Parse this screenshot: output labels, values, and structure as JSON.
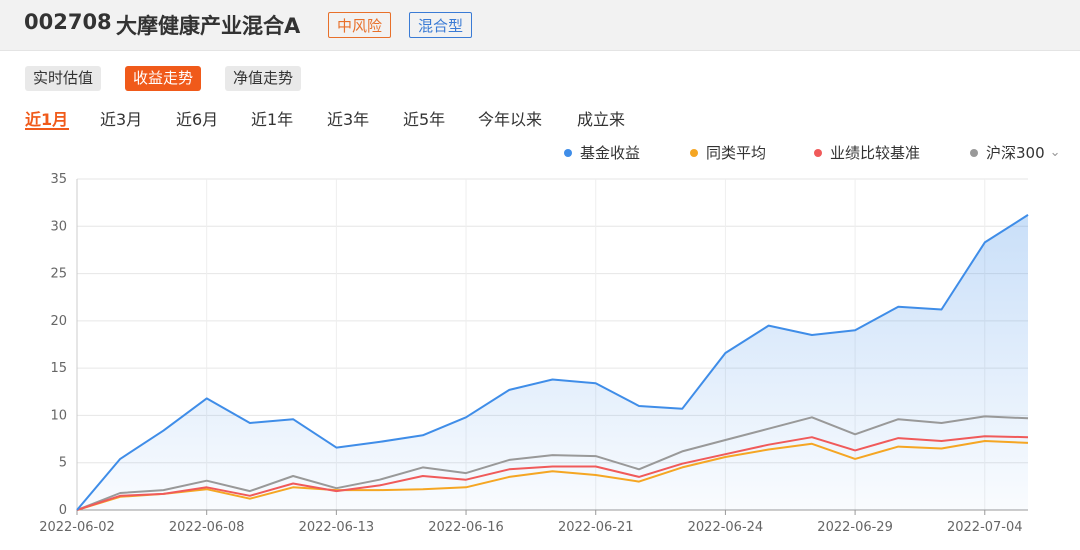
{
  "header": {
    "code": "002708",
    "name": "大摩健康产业混合A",
    "risk_tag": "中风险",
    "type_tag": "混合型"
  },
  "modes": [
    {
      "label": "实时估值",
      "active": false
    },
    {
      "label": "收益走势",
      "active": true
    },
    {
      "label": "净值走势",
      "active": false
    }
  ],
  "periods": [
    {
      "label": "近1月",
      "active": true
    },
    {
      "label": "近3月",
      "active": false
    },
    {
      "label": "近6月",
      "active": false
    },
    {
      "label": "近1年",
      "active": false
    },
    {
      "label": "近3年",
      "active": false
    },
    {
      "label": "近5年",
      "active": false
    },
    {
      "label": "今年以来",
      "active": false
    },
    {
      "label": "成立来",
      "active": false
    }
  ],
  "chart_data": {
    "type": "line",
    "title": "",
    "xlabel": "",
    "ylabel": "",
    "ylim": [
      0,
      35
    ],
    "yticks": [
      0,
      5,
      10,
      15,
      20,
      25,
      30,
      35
    ],
    "xtick_labels": [
      "2022-06-02",
      "2022-06-08",
      "2022-06-13",
      "2022-06-16",
      "2022-06-21",
      "2022-06-24",
      "2022-06-29",
      "2022-07-04"
    ],
    "xtick_indices": [
      0,
      3,
      6,
      9,
      12,
      15,
      18,
      21
    ],
    "grid": true,
    "legend": "top-right",
    "x": [
      "2022-06-02",
      "2022-06-06",
      "2022-06-07",
      "2022-06-08",
      "2022-06-09",
      "2022-06-10",
      "2022-06-13",
      "2022-06-14",
      "2022-06-15",
      "2022-06-16",
      "2022-06-17",
      "2022-06-20",
      "2022-06-21",
      "2022-06-22",
      "2022-06-23",
      "2022-06-24",
      "2022-06-27",
      "2022-06-28",
      "2022-06-29",
      "2022-06-30",
      "2022-07-01",
      "2022-07-04",
      "2022-07-05"
    ],
    "series": [
      {
        "name": "基金收益",
        "color": "#3f8de8",
        "area": true,
        "values": [
          0,
          5.4,
          8.4,
          11.8,
          9.2,
          9.6,
          6.6,
          7.2,
          7.9,
          9.8,
          12.7,
          13.8,
          13.4,
          11.0,
          10.7,
          16.6,
          19.5,
          18.5,
          19.0,
          21.5,
          21.2,
          28.3,
          31.2
        ]
      },
      {
        "name": "同类平均",
        "color": "#f5a623",
        "area": false,
        "values": [
          0,
          1.4,
          1.7,
          2.2,
          1.2,
          2.4,
          2.1,
          2.1,
          2.2,
          2.4,
          3.5,
          4.1,
          3.7,
          3.0,
          4.5,
          5.6,
          6.4,
          7.0,
          5.4,
          6.7,
          6.5,
          7.3,
          7.1
        ]
      },
      {
        "name": "业绩比较基准",
        "color": "#f05a5a",
        "area": false,
        "values": [
          0,
          1.5,
          1.7,
          2.4,
          1.5,
          2.8,
          2.0,
          2.6,
          3.6,
          3.2,
          4.3,
          4.6,
          4.6,
          3.5,
          4.9,
          5.9,
          6.9,
          7.7,
          6.3,
          7.6,
          7.3,
          7.8,
          7.7
        ]
      },
      {
        "name": "沪深300",
        "color": "#999999",
        "area": false,
        "values": [
          0,
          1.8,
          2.1,
          3.1,
          2.0,
          3.6,
          2.3,
          3.2,
          4.5,
          3.9,
          5.3,
          5.8,
          5.7,
          4.3,
          6.2,
          7.4,
          8.6,
          9.8,
          8.0,
          9.6,
          9.2,
          9.9,
          9.7
        ]
      }
    ]
  }
}
